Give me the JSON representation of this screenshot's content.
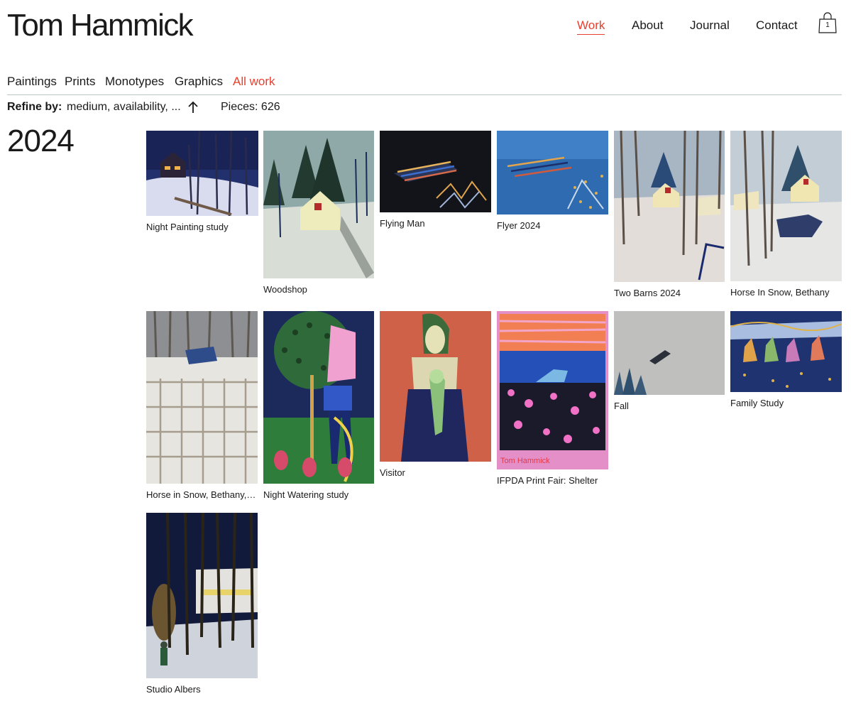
{
  "header": {
    "site_title": "Tom Hammick",
    "nav": [
      {
        "label": "Work",
        "active": true
      },
      {
        "label": "About",
        "active": false
      },
      {
        "label": "Journal",
        "active": false
      },
      {
        "label": "Contact",
        "active": false
      }
    ],
    "cart_count": "1"
  },
  "subnav": [
    {
      "label": "Paintings",
      "active": false
    },
    {
      "label": "Prints",
      "active": false
    },
    {
      "label": "Monotypes",
      "active": false
    },
    {
      "label": "Graphics",
      "active": false
    },
    {
      "label": "All work",
      "active": true
    }
  ],
  "toolbar": {
    "refine_label": "Refine by:",
    "refine_value": "medium, availability, ...",
    "pieces": "Pieces: 626"
  },
  "year_heading": "2024",
  "artworks": [
    {
      "title": "Night Painting study"
    },
    {
      "title": "Woodshop"
    },
    {
      "title": "Flying Man"
    },
    {
      "title": "Flyer 2024"
    },
    {
      "title": "Two Barns 2024"
    },
    {
      "title": "Horse In Snow, Bethany"
    },
    {
      "title": "Horse in Snow, Bethany, s..."
    },
    {
      "title": "Night Watering study"
    },
    {
      "title": "Visitor"
    },
    {
      "title": "IFPDA Print Fair: Shelter"
    },
    {
      "title": "Fall"
    },
    {
      "title": "Family Study"
    },
    {
      "title": "Studio Albers"
    }
  ],
  "colors": {
    "accent": "#e8402e",
    "text": "#1a1a1a",
    "rule": "#b9c6c6",
    "background": "#ffffff"
  }
}
